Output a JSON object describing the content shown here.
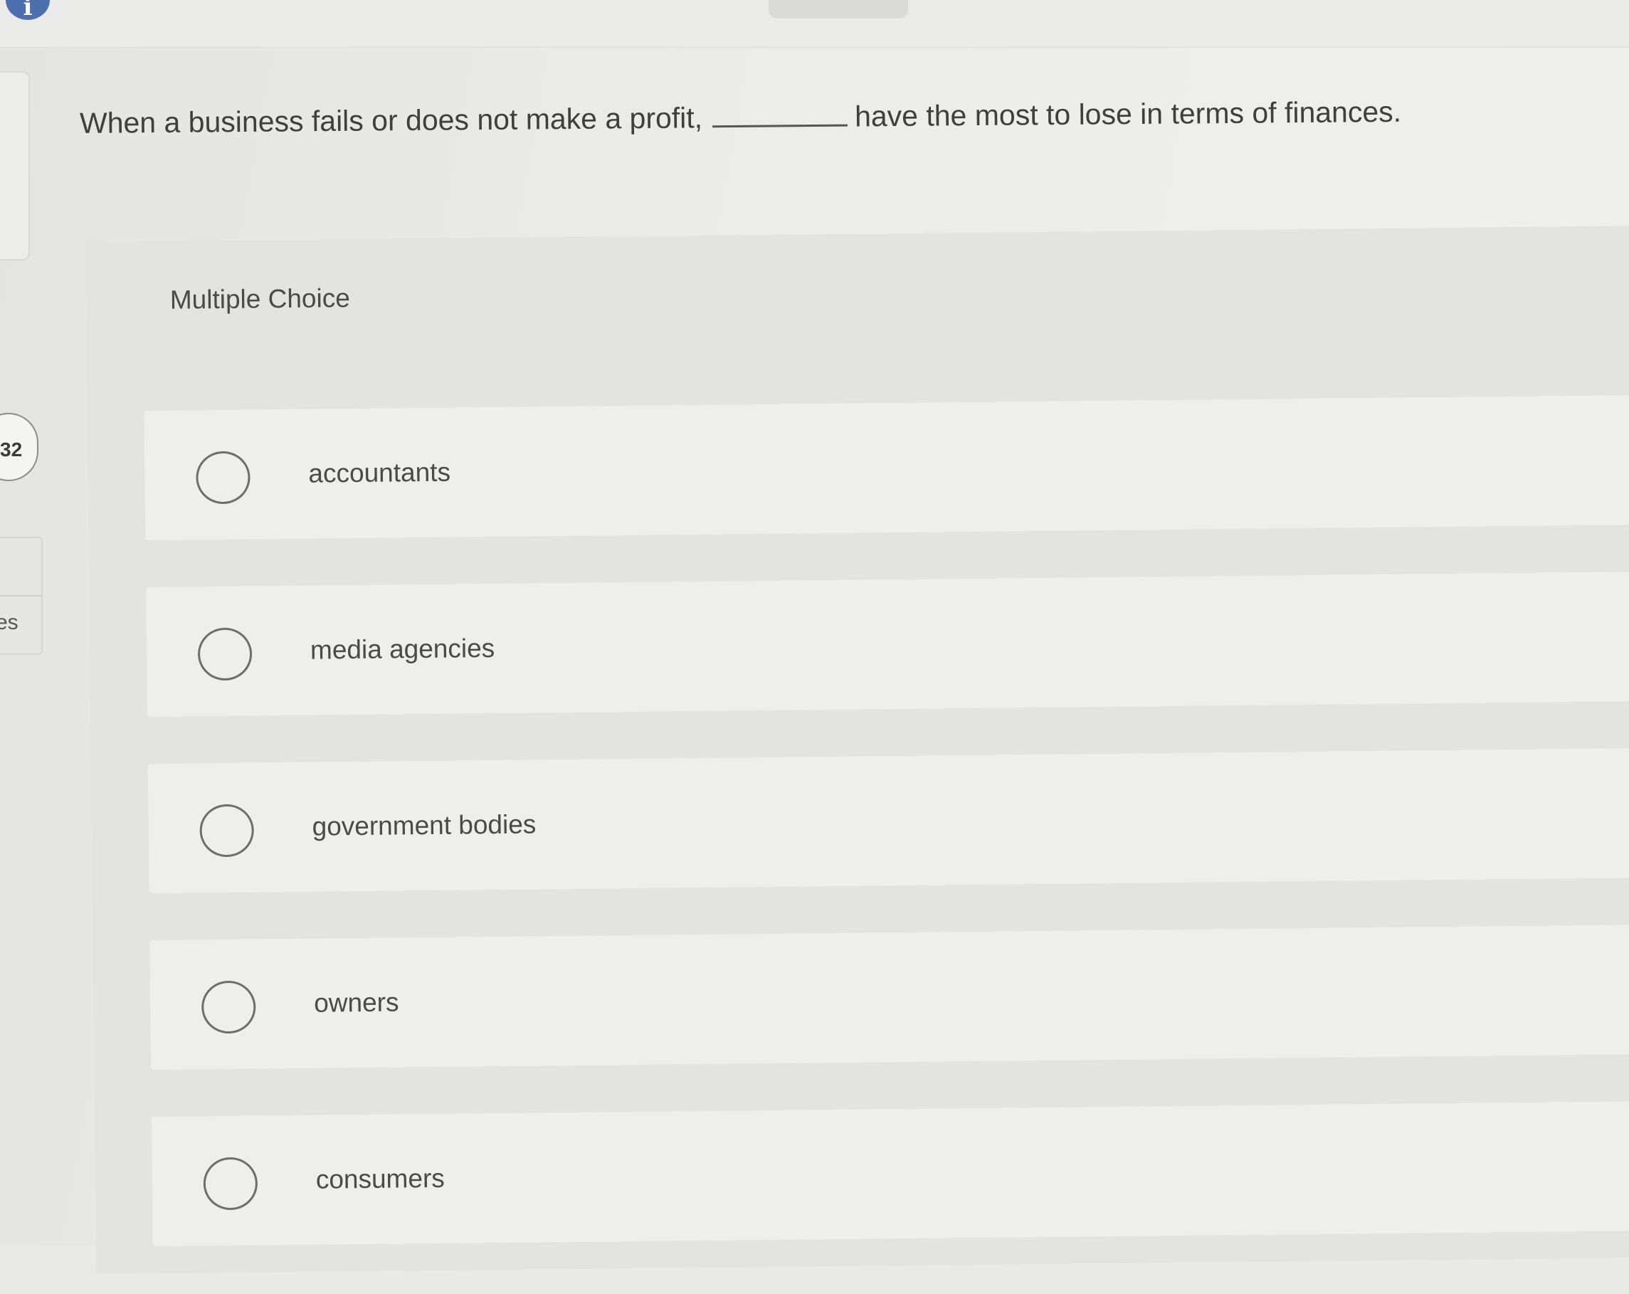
{
  "question": {
    "text_before": "When a business fails or does not make a profit,",
    "text_after": "have the most to lose in terms of finances."
  },
  "sidebar": {
    "question_number": "32",
    "partial_label": "es"
  },
  "mc": {
    "label": "Multiple Choice",
    "choices": [
      {
        "label": "accountants",
        "selected": false
      },
      {
        "label": "media agencies",
        "selected": false
      },
      {
        "label": "government bodies",
        "selected": false
      },
      {
        "label": "owners",
        "selected": false
      },
      {
        "label": "consumers",
        "selected": false
      }
    ]
  },
  "icons": {
    "info": "info-icon"
  },
  "colors": {
    "info_icon": "#4d6fae",
    "radio_border": "#6d6d6d",
    "choice_bg": "#eeeeec"
  }
}
